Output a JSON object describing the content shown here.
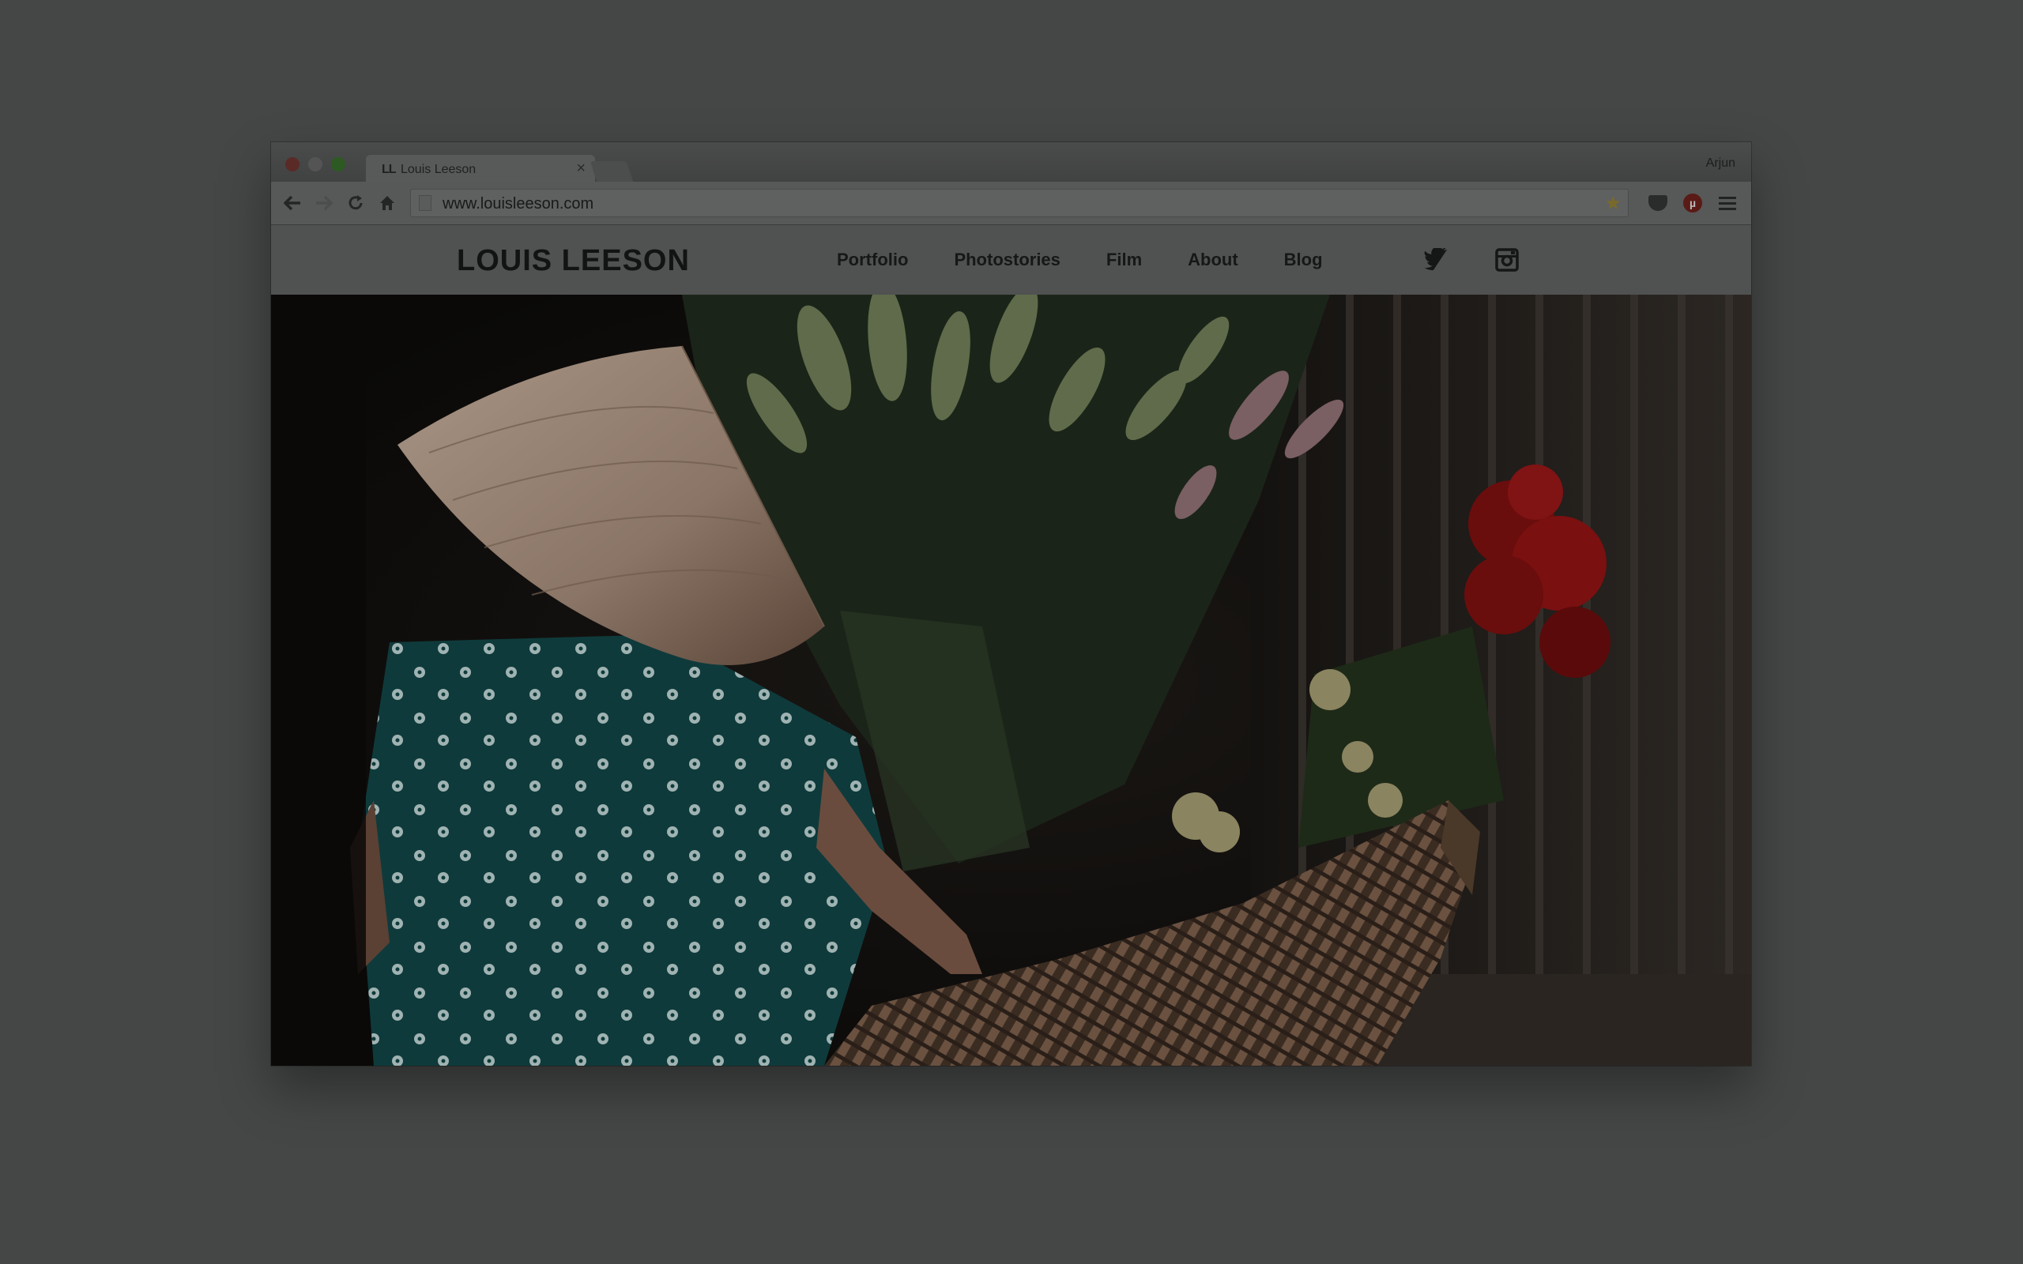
{
  "browser": {
    "tab_title": "Louis Leeson",
    "tab_favicon": "LL",
    "tab_close": "×",
    "profile_name": "Arjun",
    "url": "www.louisleeson.com",
    "icons": {
      "back": "back-arrow-icon",
      "forward": "forward-arrow-icon",
      "reload": "reload-icon",
      "home": "home-icon",
      "bookmark": "star-icon",
      "pocket": "pocket-icon",
      "ublock": "ublock-icon",
      "menu": "hamburger-menu-icon"
    },
    "ublock_badge": "µ"
  },
  "site": {
    "logo": "LOUIS LEESON",
    "nav": {
      "portfolio": "Portfolio",
      "photostories": "Photostories",
      "film": "Film",
      "about": "About",
      "blog": "Blog"
    },
    "social_icons": [
      "twitter-icon",
      "instagram-icon"
    ]
  },
  "colors": {
    "backdrop": "#454747",
    "red_traffic": "#5a2a27",
    "green_traffic": "#2c5a22"
  }
}
